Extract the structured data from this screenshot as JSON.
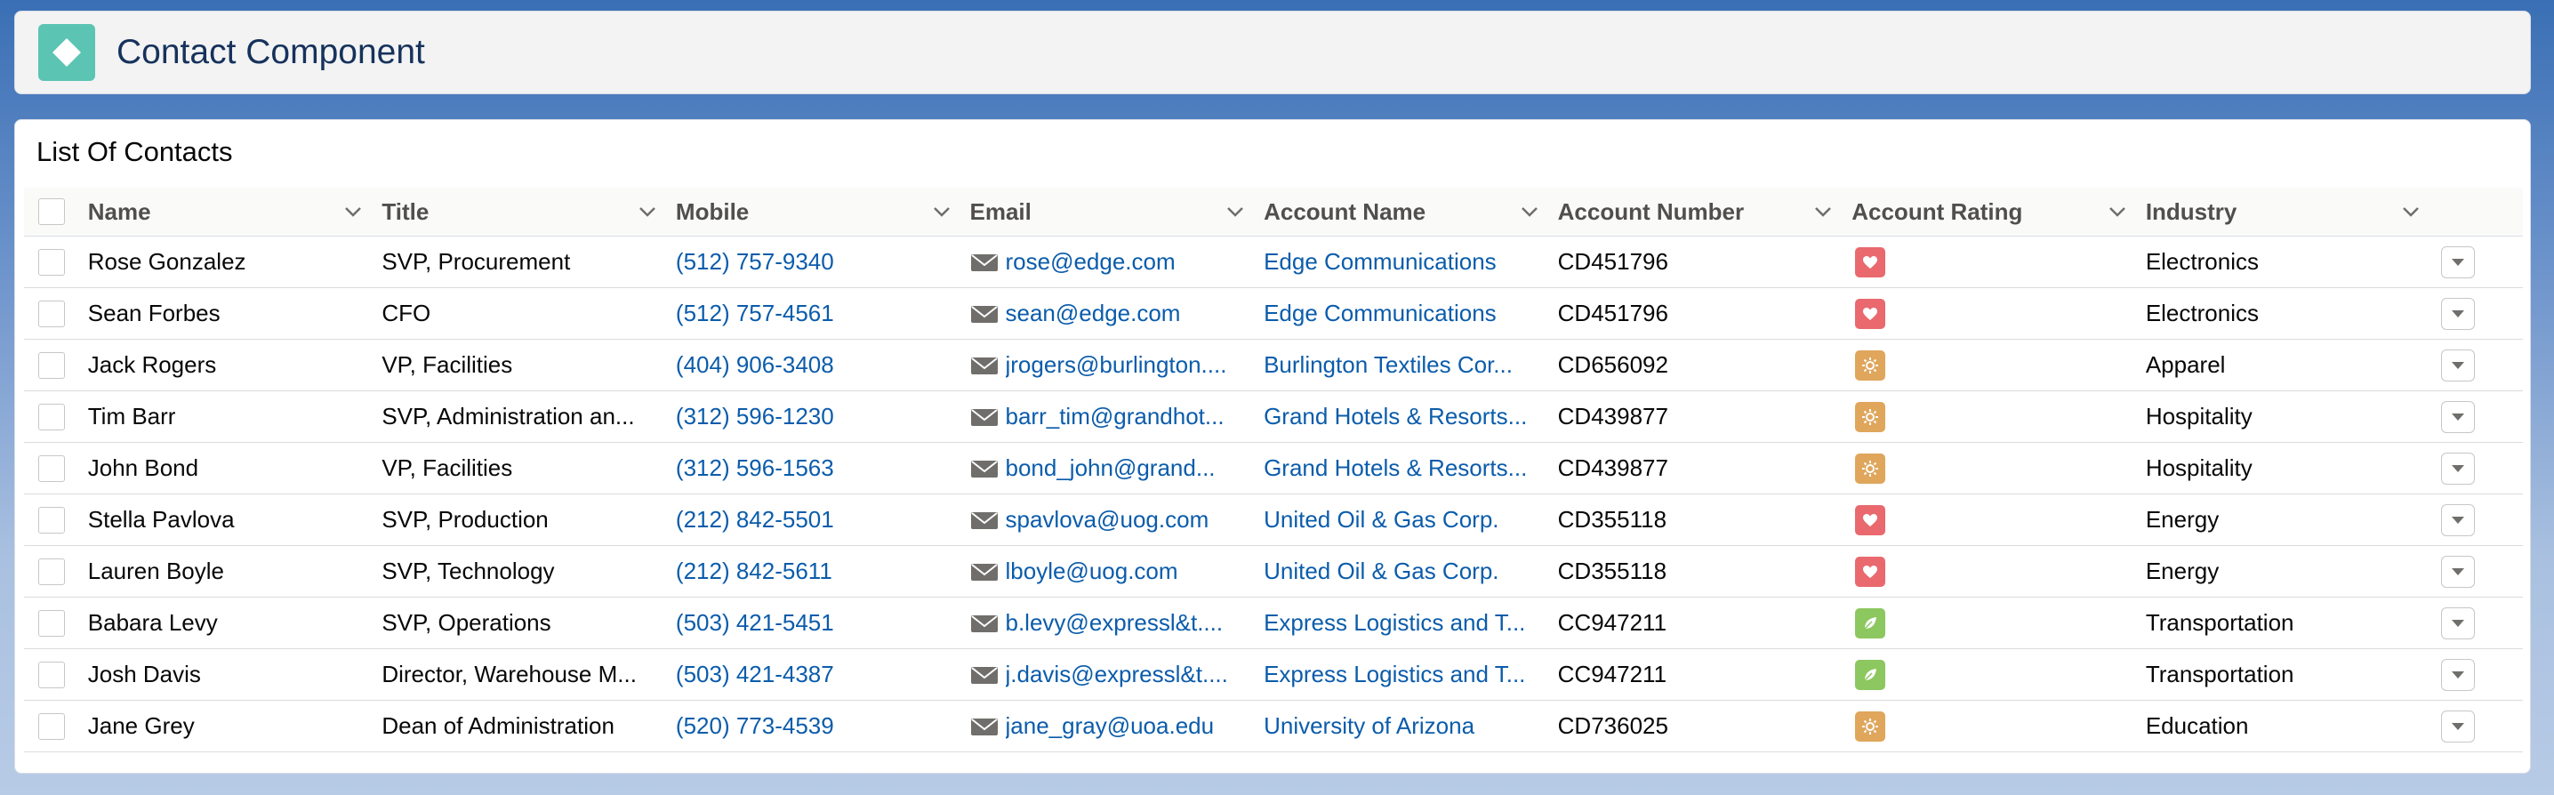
{
  "header": {
    "title": "Contact Component",
    "icon": "contact-component-icon",
    "icon_color": "#5bc4b3"
  },
  "card": {
    "title": "List Of Contacts"
  },
  "columns": [
    "Name",
    "Title",
    "Mobile",
    "Email",
    "Account Name",
    "Account Number",
    "Account Rating",
    "Industry"
  ],
  "rating_colors": {
    "Hot": "#e9696e",
    "Warm": "#dfa65c",
    "Cold": "#8cc75f"
  },
  "rows": [
    {
      "name": "Rose Gonzalez",
      "title": "SVP, Procurement",
      "mobile": "(512) 757-9340",
      "email": "rose@edge.com",
      "account": "Edge Communications",
      "number": "CD451796",
      "rating": "Hot",
      "industry": "Electronics"
    },
    {
      "name": "Sean Forbes",
      "title": "CFO",
      "mobile": "(512) 757-4561",
      "email": "sean@edge.com",
      "account": "Edge Communications",
      "number": "CD451796",
      "rating": "Hot",
      "industry": "Electronics"
    },
    {
      "name": "Jack Rogers",
      "title": "VP, Facilities",
      "mobile": "(404) 906-3408",
      "email": "jrogers@burlington....",
      "account": "Burlington Textiles Cor...",
      "number": "CD656092",
      "rating": "Warm",
      "industry": "Apparel"
    },
    {
      "name": "Tim Barr",
      "title": "SVP, Administration an...",
      "mobile": "(312) 596-1230",
      "email": "barr_tim@grandhot...",
      "account": "Grand Hotels & Resorts...",
      "number": "CD439877",
      "rating": "Warm",
      "industry": "Hospitality"
    },
    {
      "name": "John Bond",
      "title": "VP, Facilities",
      "mobile": "(312) 596-1563",
      "email": "bond_john@grand...",
      "account": "Grand Hotels & Resorts...",
      "number": "CD439877",
      "rating": "Warm",
      "industry": "Hospitality"
    },
    {
      "name": "Stella Pavlova",
      "title": "SVP, Production",
      "mobile": "(212) 842-5501",
      "email": "spavlova@uog.com",
      "account": "United Oil & Gas Corp.",
      "number": "CD355118",
      "rating": "Hot",
      "industry": "Energy"
    },
    {
      "name": "Lauren Boyle",
      "title": "SVP, Technology",
      "mobile": "(212) 842-5611",
      "email": "lboyle@uog.com",
      "account": "United Oil & Gas Corp.",
      "number": "CD355118",
      "rating": "Hot",
      "industry": "Energy"
    },
    {
      "name": "Babara Levy",
      "title": "SVP, Operations",
      "mobile": "(503) 421-5451",
      "email": "b.levy@expressl&t....",
      "account": "Express Logistics and T...",
      "number": "CC947211",
      "rating": "Cold",
      "industry": "Transportation"
    },
    {
      "name": "Josh Davis",
      "title": "Director, Warehouse M...",
      "mobile": "(503) 421-4387",
      "email": "j.davis@expressl&t....",
      "account": "Express Logistics and T...",
      "number": "CC947211",
      "rating": "Cold",
      "industry": "Transportation"
    },
    {
      "name": "Jane Grey",
      "title": "Dean of Administration",
      "mobile": "(520) 773-4539",
      "email": "jane_gray@uoa.edu",
      "account": "University of Arizona",
      "number": "CD736025",
      "rating": "Warm",
      "industry": "Education"
    }
  ]
}
